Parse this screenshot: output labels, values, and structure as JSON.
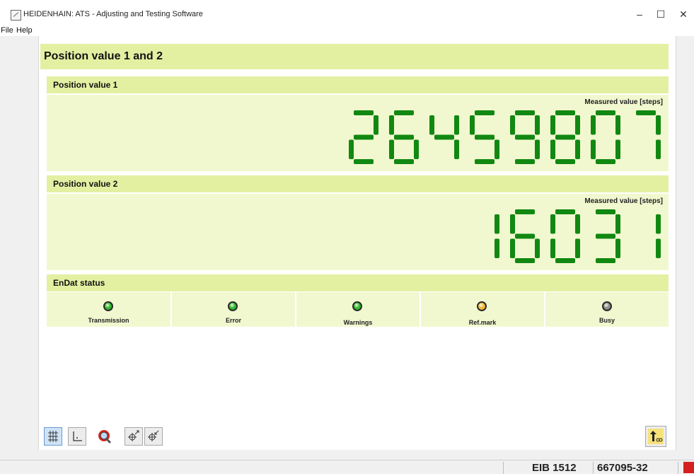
{
  "window": {
    "title": "HEIDENHAIN: ATS - Adjusting and Testing Software",
    "minimize": "–",
    "maximize": "☐",
    "close": "✕"
  },
  "menu": {
    "file": "File",
    "help": "Help"
  },
  "page": {
    "title": "Position value 1 and 2"
  },
  "position1": {
    "header": "Position value 1",
    "measured_label": "Measured value [steps]",
    "value": "26459807"
  },
  "position2": {
    "header": "Position value 2",
    "measured_label": "Measured value [steps]",
    "value": "16031"
  },
  "endat": {
    "header": "EnDat status",
    "indicators": [
      {
        "label": "Transmission",
        "color": "#2fb82f"
      },
      {
        "label": "Error",
        "color": "#2fb82f"
      },
      {
        "label": "Warnings",
        "color": "#2fb82f"
      },
      {
        "label": "Ref.mark",
        "color": "#f2b735"
      },
      {
        "label": "Busy",
        "color": "#8a8a8a"
      }
    ]
  },
  "colors": {
    "header_bg": "#e3f0a2",
    "body_bg": "#f1f8cf",
    "segment": "#118811"
  },
  "toolbar": {
    "icons": [
      "grid-icon",
      "axis-icon",
      "magnifier-icon",
      "crosshair-out-icon",
      "crosshair-in-icon",
      "exit-icon"
    ]
  },
  "statusbar": {
    "device": "EIB 1512",
    "id": "667095-32"
  }
}
